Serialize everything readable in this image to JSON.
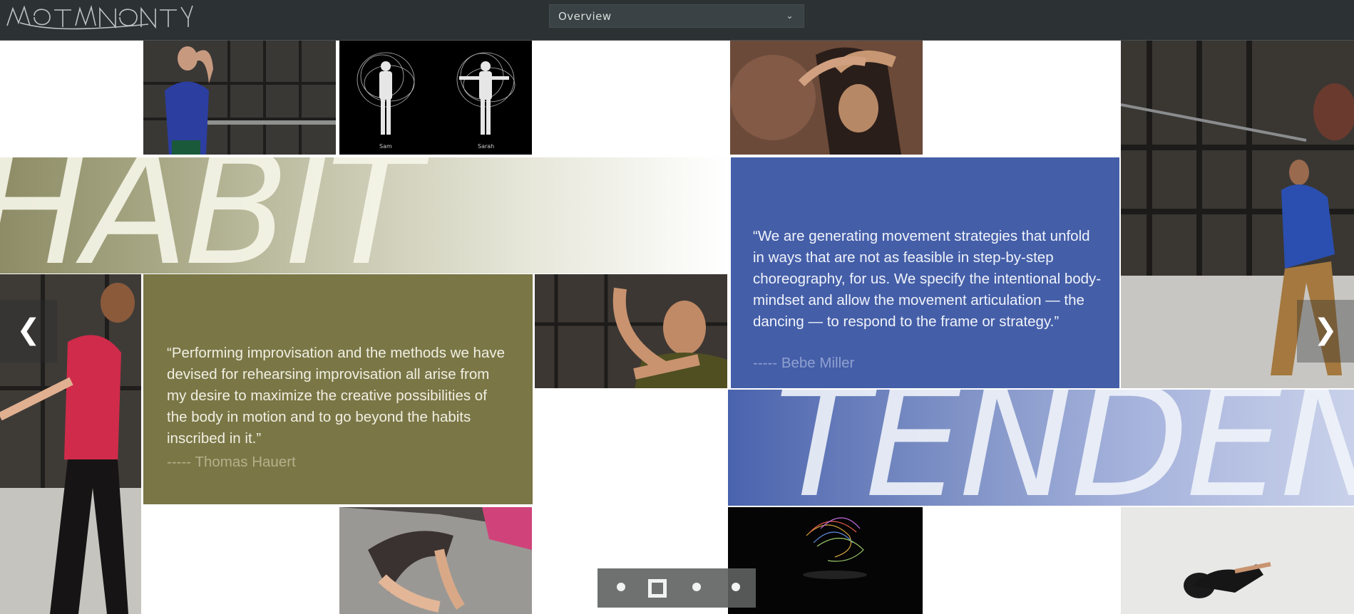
{
  "header": {
    "logo_alt": "Motion Bank",
    "nav_select_value": "Overview"
  },
  "photos": [
    {
      "name": "photo-man-blue-tank",
      "caption": ""
    },
    {
      "name": "photo-silhouettes",
      "captions": [
        "Sam",
        "Sarah"
      ]
    },
    {
      "name": "photo-dancers-arms-overhead"
    },
    {
      "name": "photo-studio-man-blue-shirt"
    },
    {
      "name": "photo-woman-red-shirt"
    },
    {
      "name": "photo-man-olive-shirt"
    },
    {
      "name": "photo-feet-floor"
    },
    {
      "name": "photo-colorful-visualization"
    },
    {
      "name": "photo-dancer-on-floor"
    }
  ],
  "banners": {
    "habit": "HABIT",
    "tendency": "TENDENC"
  },
  "quotes": {
    "thomas": {
      "text": "“Performing improvisation and the methods we have devised for rehearsing improvisation all arise from my desire to maximize the creative possibilities of the body in motion and to go beyond the habits inscribed in it.”",
      "author": "----- Thomas Hauert"
    },
    "bebe": {
      "text": "“We are generating movement strategies that unfold in ways that are not as feasible in step-by-step choreography, for us. We specify the intentional body-mindset and allow the movement articulation — the dancing — to respond to the frame or strategy.”",
      "author": "----- Bebe Miller"
    }
  },
  "controls": {
    "prev_glyph": "❮",
    "next_glyph": "❯",
    "pager": {
      "count": 4,
      "active_index": 1
    }
  },
  "colors": {
    "topbar": "#2c3133",
    "olive": "#7a7646",
    "blue": "#445ea8"
  }
}
